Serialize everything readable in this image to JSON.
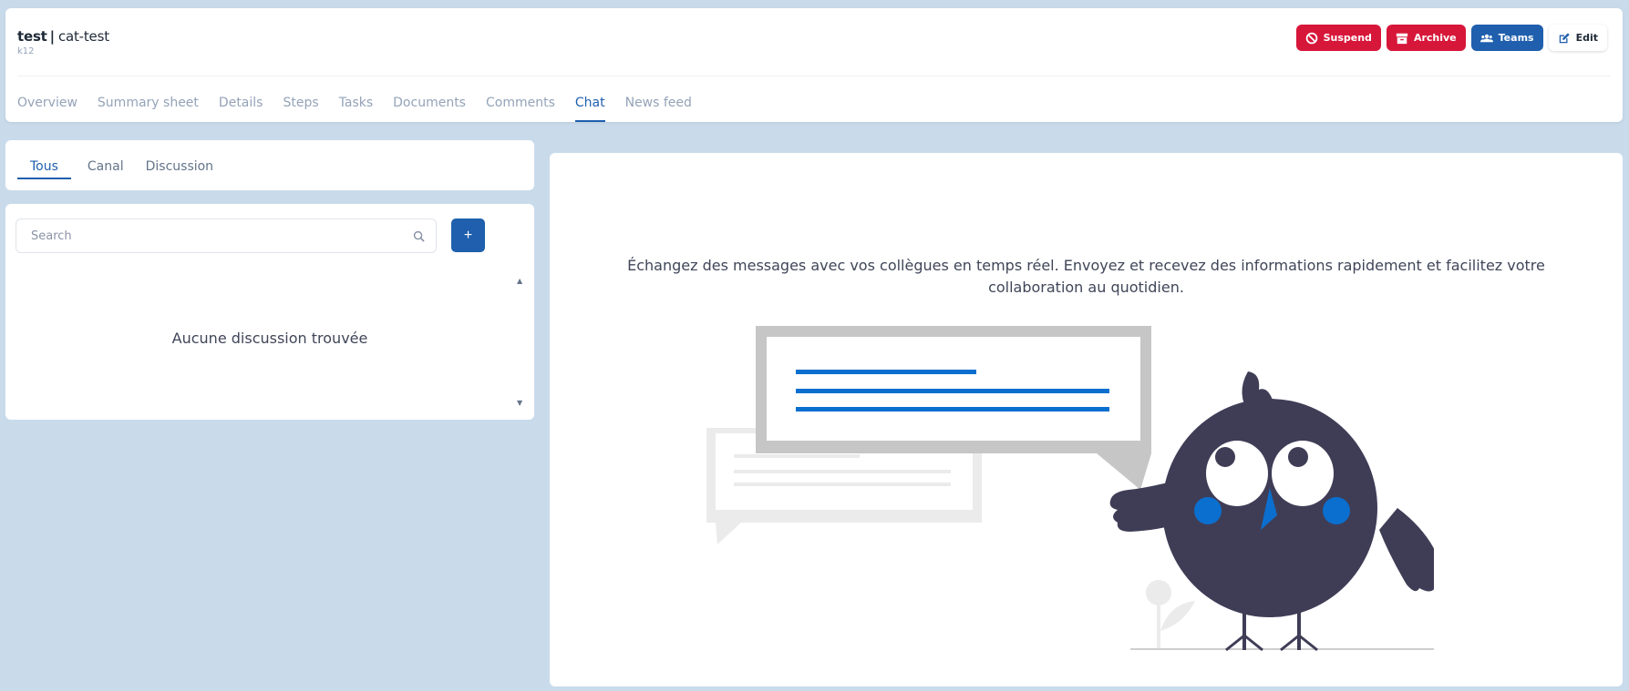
{
  "header": {
    "title_bold": "test",
    "title_sep": "|",
    "title_rest": "cat-test",
    "subtitle": "k12",
    "actions": {
      "suspend": "Suspend",
      "archive": "Archive",
      "teams": "Teams",
      "edit": "Edit"
    },
    "tabs": [
      {
        "label": "Overview",
        "active": false
      },
      {
        "label": "Summary sheet",
        "active": false
      },
      {
        "label": "Details",
        "active": false
      },
      {
        "label": "Steps",
        "active": false
      },
      {
        "label": "Tasks",
        "active": false
      },
      {
        "label": "Documents",
        "active": false
      },
      {
        "label": "Comments",
        "active": false
      },
      {
        "label": "Chat",
        "active": true
      },
      {
        "label": "News feed",
        "active": false
      }
    ]
  },
  "filters": {
    "tabs": [
      {
        "label": "Tous",
        "active": true
      },
      {
        "label": "Canal",
        "active": false
      },
      {
        "label": "Discussion",
        "active": false
      }
    ]
  },
  "list": {
    "search_placeholder": "Search",
    "add_label": "+",
    "empty_text": "Aucune discussion trouvée"
  },
  "main": {
    "description": "Échangez des messages avec vos collègues en temps réel. Envoyez et recevez des informations rapidement et facilitez votre collaboration au quotidien."
  },
  "colors": {
    "primary": "#1f5fad",
    "danger": "#d7173a",
    "background": "#c9dbeb",
    "bird": "#3f3d56",
    "accent_blue": "#0b6fcf"
  }
}
